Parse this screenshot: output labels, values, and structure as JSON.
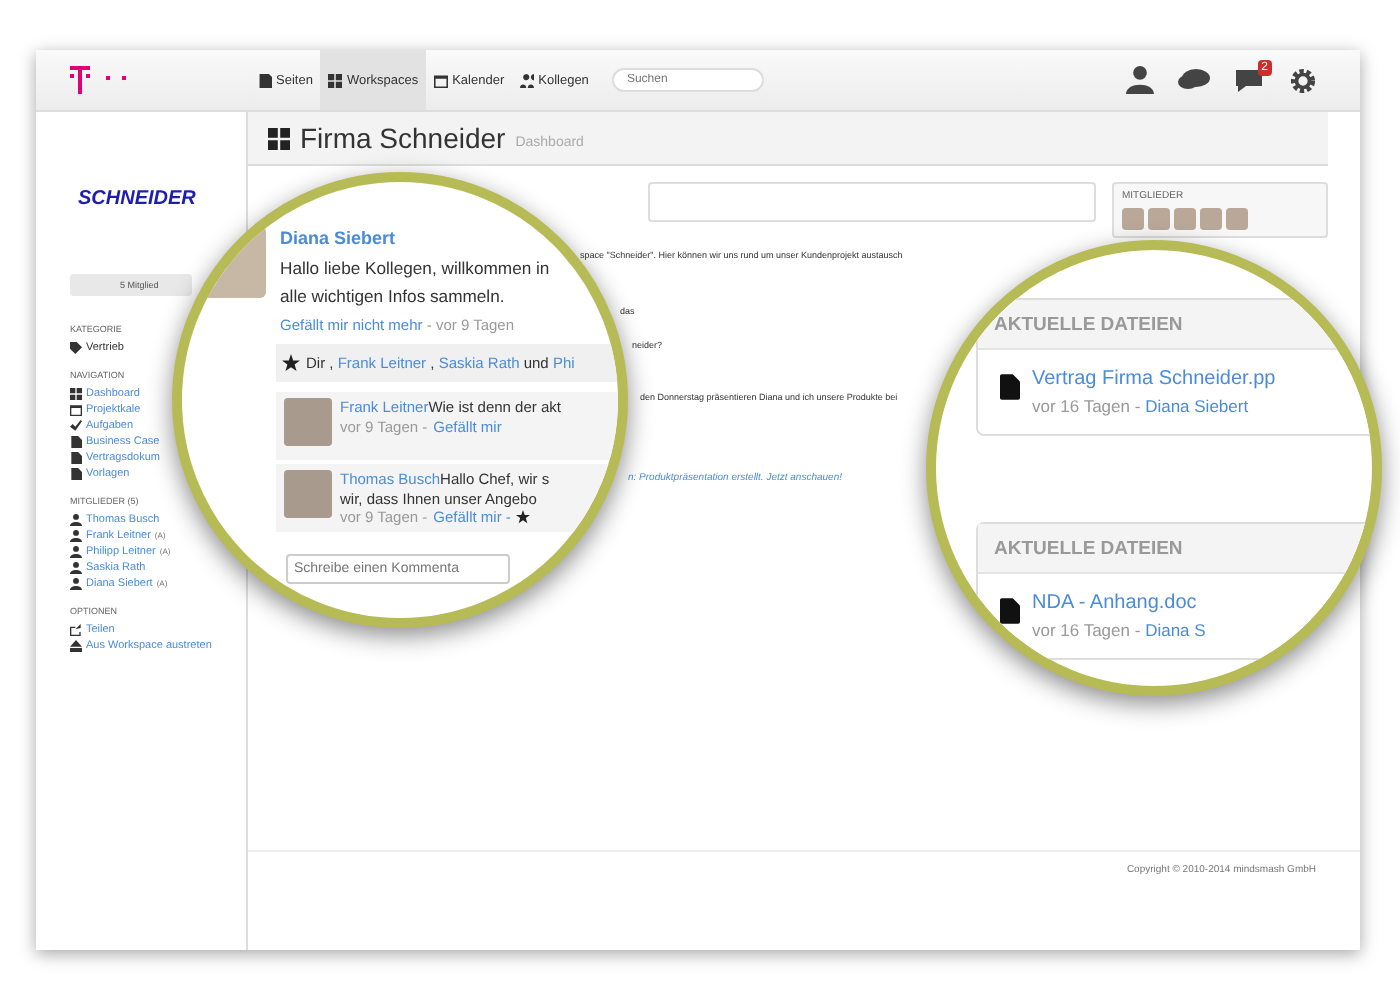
{
  "topbar": {
    "nav": [
      {
        "label": "Seiten",
        "selected": false,
        "kind": "pages"
      },
      {
        "label": "Workspaces",
        "selected": true,
        "kind": "grid"
      },
      {
        "label": "Kalender",
        "selected": false,
        "kind": "calendar"
      },
      {
        "label": "Kollegen",
        "selected": false,
        "kind": "people"
      }
    ],
    "search": {
      "placeholder": "Suchen"
    },
    "notification_count": "2"
  },
  "workspace": {
    "title": "Firma Schneider",
    "subtitle": "Dashboard"
  },
  "sidebar": {
    "logo": "SCHNEIDER",
    "members_button": "5 Mitglied",
    "sections": [
      {
        "title": "KATEGORIE",
        "items": [
          {
            "label": "Vertrieb",
            "kind": "tag",
            "link": false
          }
        ]
      },
      {
        "title": "NAVIGATION",
        "items": [
          {
            "label": "Dashboard",
            "kind": "grid",
            "link": true
          },
          {
            "label": "Projektkale",
            "kind": "calendar",
            "link": true
          },
          {
            "label": "Aufgaben",
            "kind": "check",
            "link": true
          },
          {
            "label": "Business Case",
            "kind": "file",
            "link": true
          },
          {
            "label": "Vertragsdokum",
            "kind": "file",
            "link": true
          },
          {
            "label": "Vorlagen",
            "kind": "file",
            "link": true
          }
        ]
      },
      {
        "title": "MITGLIEDER (5)",
        "items": [
          {
            "label": "Thomas Busch",
            "kind": "user",
            "link": true
          },
          {
            "label": "Frank Leitner",
            "kind": "user",
            "link": true,
            "badge": "(A)"
          },
          {
            "label": "Philipp Leitner",
            "kind": "user",
            "link": true,
            "badge": "(A)"
          },
          {
            "label": "Saskia Rath",
            "kind": "user",
            "link": true
          },
          {
            "label": "Diana Siebert",
            "kind": "user",
            "link": true,
            "badge": "(A)"
          }
        ]
      },
      {
        "title": "OPTIONEN",
        "items": [
          {
            "label": "Teilen",
            "kind": "share",
            "link": true
          },
          {
            "label": "Aus Workspace austreten",
            "kind": "exit",
            "link": true
          }
        ]
      }
    ]
  },
  "feed_fragments": [
    {
      "text": "space \"Schneider\". Hier können wir uns rund um unser Kundenprojekt austausch",
      "kind": "text"
    },
    {
      "text": "das",
      "kind": "small"
    },
    {
      "text": "neider?",
      "kind": "small"
    },
    {
      "text": "den Donnerstag präsentieren Diana und ich unsere Produkte bei",
      "kind": "text"
    },
    {
      "text": "n: Produktpräsentation erstellt. Jetzt anschauen!",
      "kind": "link"
    }
  ],
  "members_panel": {
    "title": "MITGLIEDER"
  },
  "magnifier_post": {
    "author": "Diana Siebert",
    "lines": [
      "Hallo liebe Kollegen, willkommen in",
      "alle wichtigen Infos sammeln."
    ],
    "unlike": "Gefällt mir nicht mehr",
    "time": "- vor 9 Tagen",
    "likes": [
      {
        "text": "Dir ,",
        "link": false
      },
      {
        "text": "Frank Leitner",
        "link": true
      },
      {
        "text": ",",
        "link": false
      },
      {
        "text": "Saskia Rath",
        "link": true
      },
      {
        "text": "und",
        "link": false
      },
      {
        "text": "Phi",
        "link": true
      }
    ],
    "comments": [
      {
        "author": "Frank Leitner",
        "lines": [
          "Wie ist denn der akt"
        ],
        "time": "vor 9 Tagen -",
        "like": "Gefällt mir",
        "starred": false
      },
      {
        "author": "Thomas Busch",
        "lines": [
          "Hallo Chef, wir s",
          "wir, dass Ihnen unser Angebo"
        ],
        "time": "vor 9 Tagen -",
        "like": "Gefällt mir -",
        "starred": true
      }
    ],
    "comment_placeholder": "Schreibe einen Kommenta"
  },
  "magnifier_files": [
    {
      "title": "AKTUELLE DATEIEN",
      "file": "Vertrag Firma Schneider.pp",
      "age": "vor 16 Tagen -",
      "author": "Diana Siebert"
    },
    {
      "title": "AKTUELLE DATEIEN",
      "file": "NDA - Anhang.doc",
      "age": "vor 16 Tagen -",
      "author": "Diana S"
    }
  ],
  "footer": {
    "copyright": "Copyright © 2010-2014 mindsmash GmbH"
  }
}
